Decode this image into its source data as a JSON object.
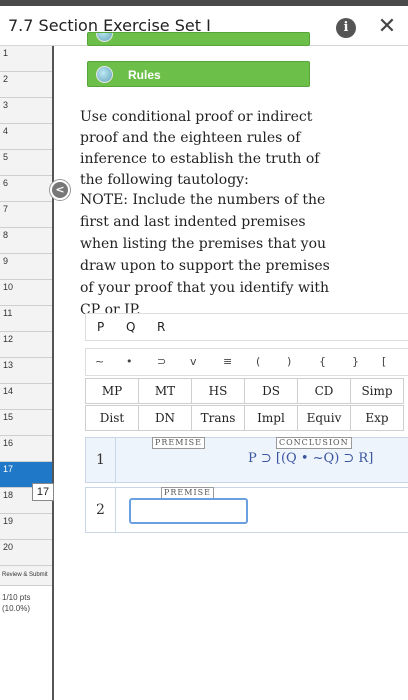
{
  "header": {
    "title": "7.7 Section Exercise Set I",
    "info_label": "i",
    "close_label": "✕"
  },
  "sidebar": {
    "questions": [
      "1",
      "2",
      "3",
      "4",
      "5",
      "6",
      "7",
      "8",
      "9",
      "10",
      "11",
      "12",
      "13",
      "14",
      "15",
      "16",
      "17",
      "18",
      "19",
      "20"
    ],
    "active_question": "17",
    "review_label": "Review & Submit",
    "points": "1/10 pts\n(10.0%)",
    "tooltip": "17"
  },
  "collapse_label": "<",
  "rules_button": {
    "label": "Rules"
  },
  "instructions": "Use conditional proof or indirect proof and the eighteen rules of inference to establish the truth of the following tautology:",
  "note": "NOTE: Include the numbers of the first and last indented premises when listing the premises that you draw upon to support the premises of your proof that you identify with CP or IP.",
  "variables": [
    "P",
    "Q",
    "R"
  ],
  "symbols": [
    "~",
    "•",
    "⊃",
    "v",
    "≡",
    "(",
    ")",
    "{",
    "}",
    "["
  ],
  "rules": [
    [
      "MP",
      "MT",
      "HS",
      "DS",
      "CD",
      "Simp"
    ],
    [
      "Dist",
      "DN",
      "Trans",
      "Impl",
      "Equiv",
      "Exp"
    ]
  ],
  "proof": {
    "line1": {
      "number": "1",
      "premise_tag": "PREMISE",
      "conclusion_tag": "CONCLUSION",
      "conclusion": "P ⊃ [(Q • ~Q) ⊃ R]"
    },
    "line2": {
      "number": "2",
      "premise_tag": "PREMISE",
      "value": ""
    }
  }
}
